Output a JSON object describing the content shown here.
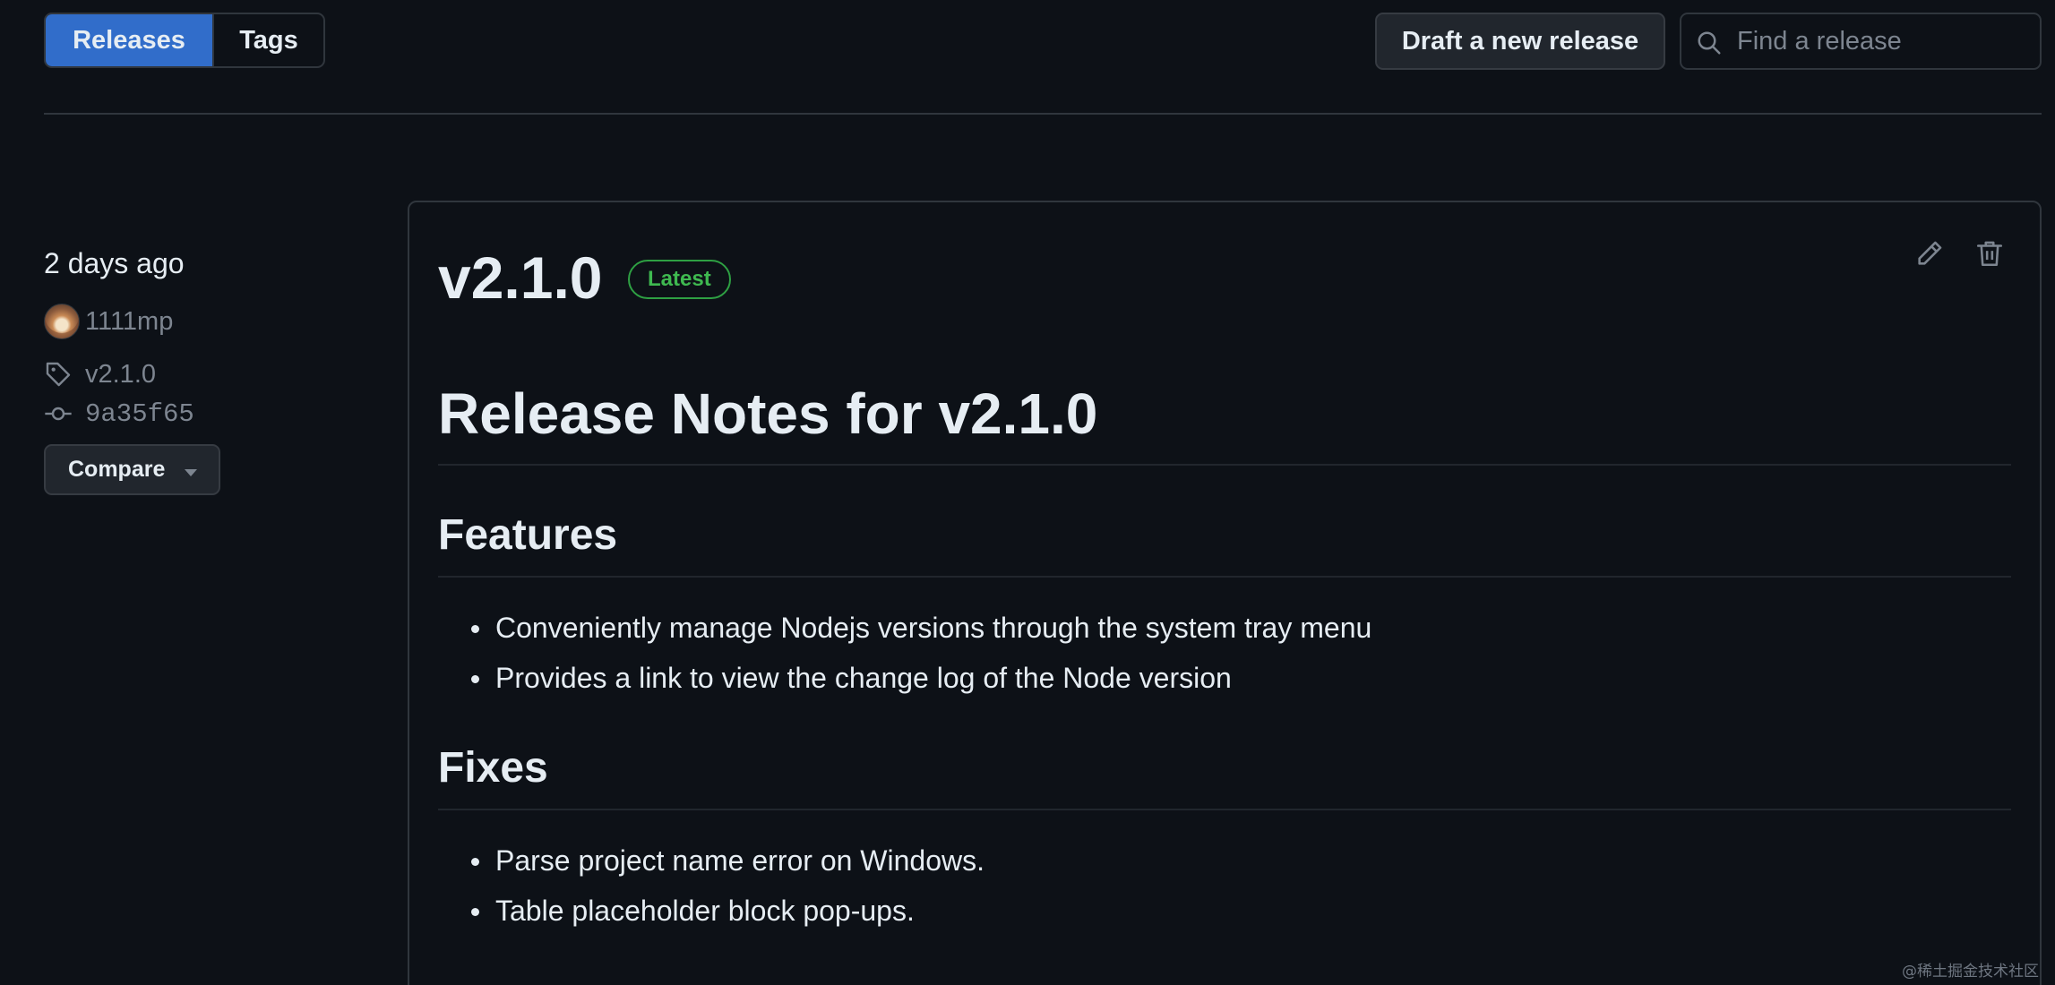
{
  "nav": {
    "releases_label": "Releases",
    "tags_label": "Tags",
    "draft_button_label": "Draft a new release",
    "search_placeholder": "Find a release"
  },
  "release": {
    "published_ago": "2 days ago",
    "author": "1111mp",
    "tag": "v2.1.0",
    "commit": "9a35f65",
    "compare_label": "Compare",
    "version": "v2.1.0",
    "badge": "Latest",
    "notes": {
      "title": "Release Notes for v2.1.0",
      "sections": [
        {
          "heading": "Features",
          "items": [
            "Conveniently manage Nodejs versions through the system tray menu",
            "Provides a link to view the change log of the Node version"
          ]
        },
        {
          "heading": "Fixes",
          "items": [
            "Parse project name error on Windows.",
            "Table placeholder block pop-ups."
          ]
        }
      ]
    }
  },
  "watermark": "@稀土掘金技术社区",
  "colors": {
    "background": "#0d1117",
    "accent": "#316dca",
    "latest_badge": "#3fb950"
  },
  "icons": [
    "search-icon",
    "tag-icon",
    "commit-icon",
    "pencil-icon",
    "trash-icon",
    "triangle-down-icon"
  ]
}
